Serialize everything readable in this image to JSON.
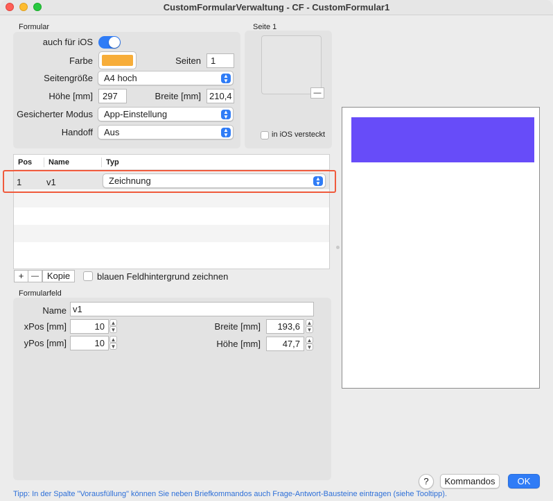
{
  "window": {
    "title": "CustomFormularVerwaltung - CF - CustomFormular1"
  },
  "formular": {
    "section_label": "Formular",
    "ios_label": "auch für iOS",
    "ios_enabled": true,
    "farbe_label": "Farbe",
    "farbe_color": "#f7ad39",
    "seiten_label": "Seiten",
    "seiten_value": "1",
    "seitengroesse_label": "Seitengröße",
    "seitengroesse_value": "A4 hoch",
    "hoehe_label": "Höhe [mm]",
    "hoehe_value": "297",
    "breite_label": "Breite [mm]",
    "breite_value": "210,4",
    "modus_label": "Gesicherter Modus",
    "modus_value": "App-Einstellung",
    "handoff_label": "Handoff",
    "handoff_value": "Aus"
  },
  "seite": {
    "label": "Seite 1",
    "remove_symbol": "—",
    "ios_hidden_label": "in iOS versteckt",
    "ios_hidden": false
  },
  "table": {
    "columns": [
      "Pos",
      "Name",
      "Typ"
    ],
    "rows": [
      {
        "pos": "1",
        "name": "v1",
        "typ": "Zeichnung"
      }
    ]
  },
  "table_toolbar": {
    "add": "+",
    "remove": "—",
    "copy": "Kopie",
    "blue_bg_label": "blauen Feldhintergrund zeichnen",
    "blue_bg": false
  },
  "formularfeld": {
    "section_label": "Formularfeld",
    "name_label": "Name",
    "name_value": "v1",
    "xpos_label": "xPos [mm]",
    "xpos_value": "10",
    "ypos_label": "yPos [mm]",
    "ypos_value": "10",
    "breite_label": "Breite [mm]",
    "breite_value": "193,6",
    "hoehe_label": "Höhe [mm]",
    "hoehe_value": "47,7"
  },
  "preview": {
    "field_color": "#674cf9"
  },
  "footer": {
    "tip": "Tipp: In der Spalte \"Vorausfüllung\" können Sie neben Briefkommandos auch Frage-Antwort-Bausteine eintragen (siehe Tooltipp).",
    "help": "?",
    "kommandos": "Kommandos",
    "ok": "OK"
  }
}
